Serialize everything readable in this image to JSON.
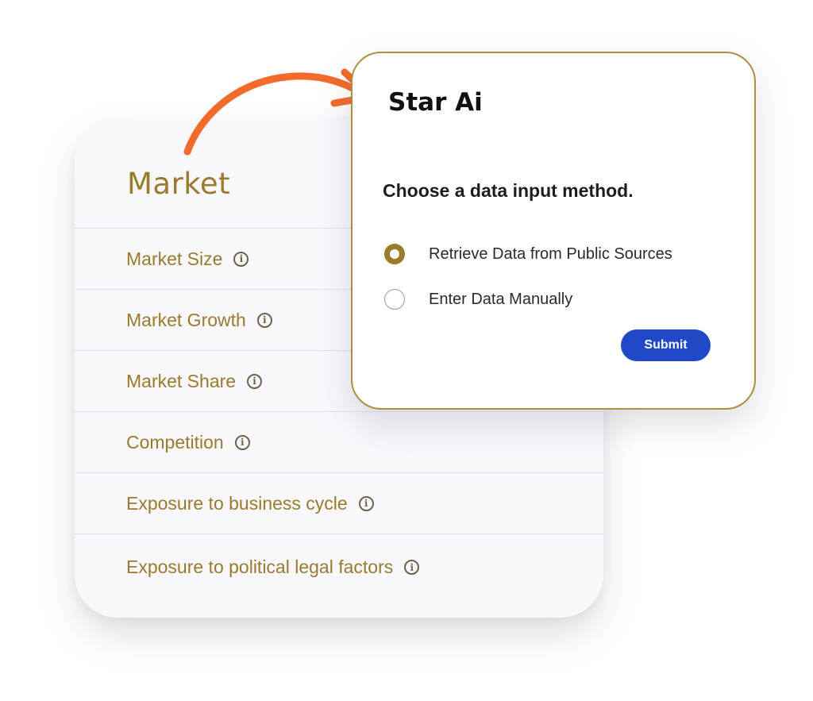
{
  "market": {
    "title": "Market",
    "rows": [
      {
        "label": "Market Size",
        "icon": "info-icon"
      },
      {
        "label": "Market Growth",
        "icon": "info-icon"
      },
      {
        "label": "Market Share",
        "icon": "info-icon"
      },
      {
        "label": "Competition",
        "icon": "info-icon"
      },
      {
        "label": "Exposure to business cycle",
        "icon": "info-icon"
      },
      {
        "label": "Exposure to political legal factors",
        "icon": "info-icon"
      }
    ]
  },
  "dialog": {
    "title": "Star Ai",
    "question": "Choose a data input method.",
    "options": [
      {
        "label": "Retrieve Data from Public Sources",
        "selected": true
      },
      {
        "label": "Enter Data Manually",
        "selected": false
      }
    ],
    "submit_label": "Submit"
  },
  "colors": {
    "accent_gold": "#9a7b2c",
    "dialog_border": "#b08d3f",
    "arrow": "#f26b2a",
    "submit_bg": "#2149c7",
    "card_bg": "#f7f7fc"
  }
}
